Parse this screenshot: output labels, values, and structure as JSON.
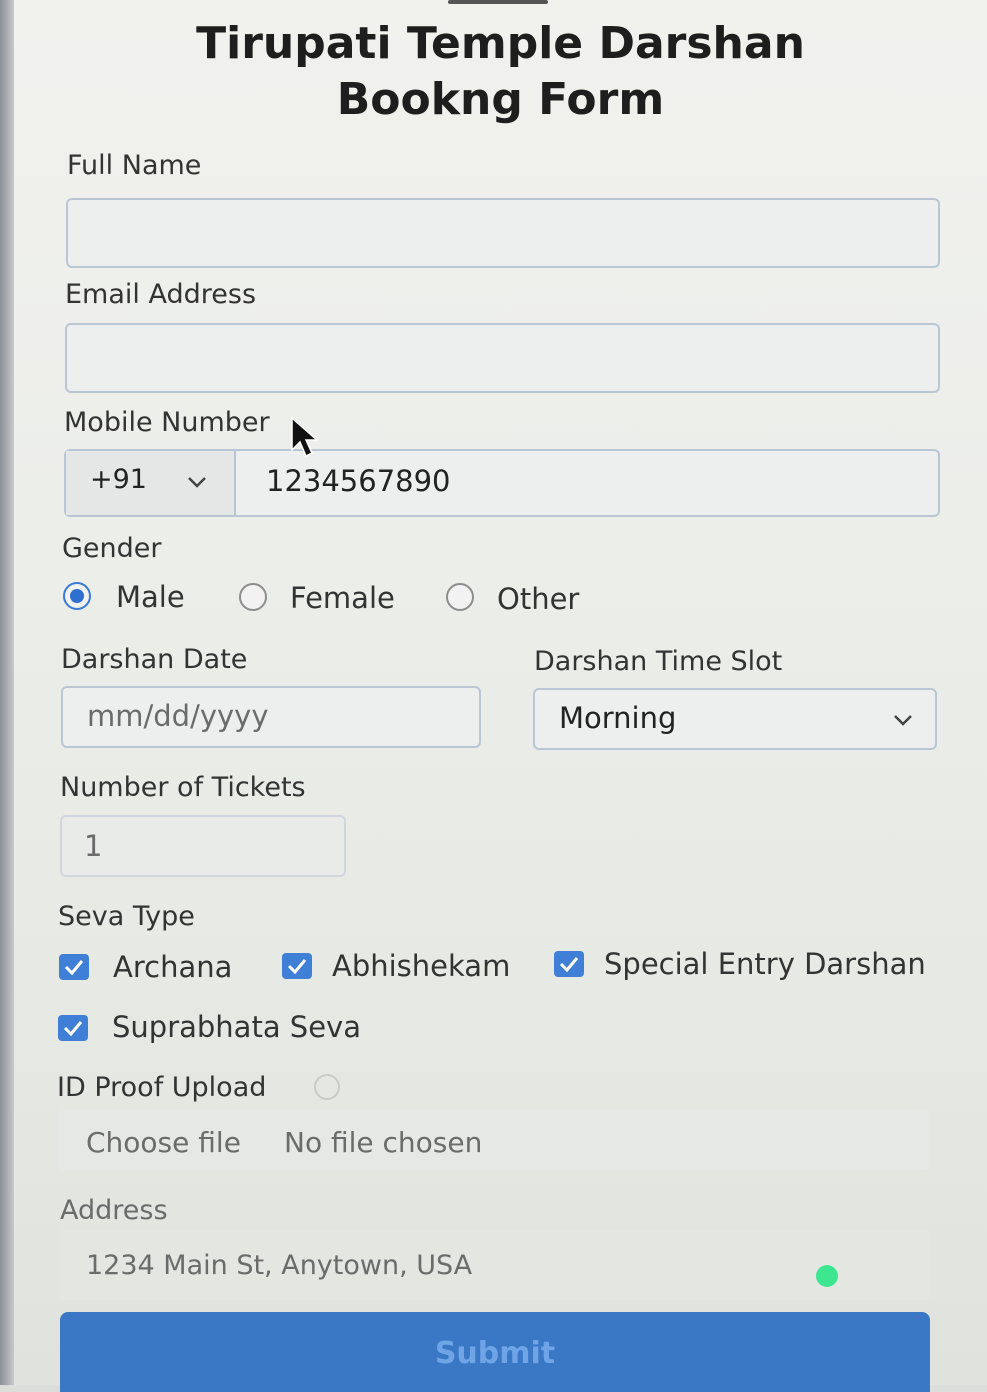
{
  "form": {
    "title": "Tirupati Temple Darshan Bookng Form",
    "full_name": {
      "label": "Full Name",
      "value": ""
    },
    "email": {
      "label": "Email Address",
      "value": ""
    },
    "mobile": {
      "label": "Mobile Number",
      "country_code": "+91",
      "value": "1234567890"
    },
    "gender": {
      "label": "Gender",
      "options": [
        {
          "label": "Male",
          "checked": true
        },
        {
          "label": "Female",
          "checked": false
        },
        {
          "label": "Other",
          "checked": false
        }
      ]
    },
    "darshan_date": {
      "label": "Darshan Date",
      "placeholder": "mm/dd/yyyy"
    },
    "time_slot": {
      "label": "Darshan Time Slot",
      "value": "Morning"
    },
    "tickets": {
      "label": "Number of Tickets",
      "value": "1"
    },
    "seva": {
      "label": "Seva Type",
      "options": [
        {
          "label": "Archana",
          "checked": true
        },
        {
          "label": "Abhishekam",
          "checked": true
        },
        {
          "label": "Special Entry Darshan",
          "checked": true
        },
        {
          "label": "Suprabhata Seva",
          "checked": true
        }
      ]
    },
    "id_proof": {
      "label": "ID Proof Upload",
      "button": "Choose file",
      "status": "No file chosen"
    },
    "address": {
      "label": "Address",
      "placeholder": "1234 Main St, Anytown, USA"
    },
    "submit_label": "Submit"
  },
  "colors": {
    "accent": "#3a78c6",
    "checkbox": "#3f7fd6",
    "page_bg": "#eceeea"
  }
}
